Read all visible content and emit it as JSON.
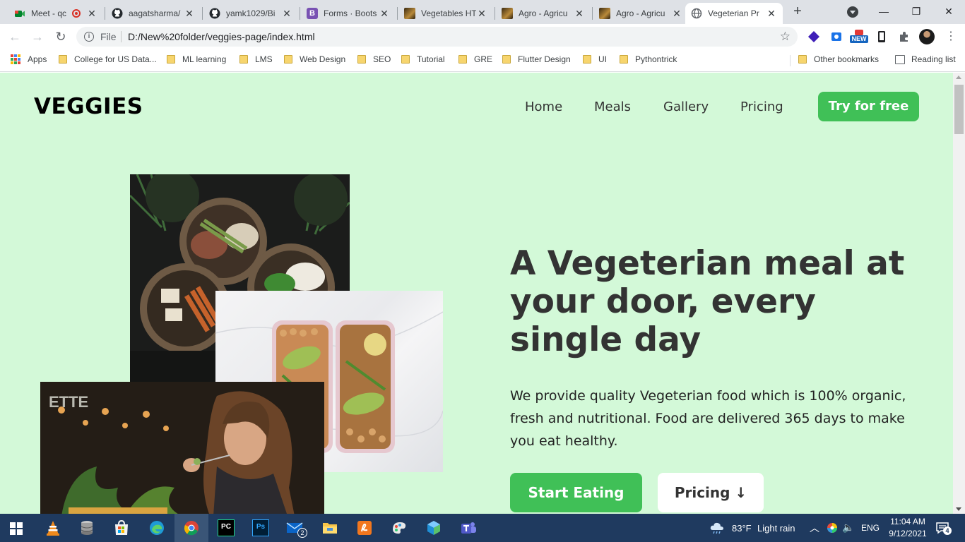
{
  "browser": {
    "tabs": [
      {
        "title": "Meet - qc",
        "icon": "google-meet-icon",
        "recording": true
      },
      {
        "title": "aagatsharma/",
        "icon": "github-icon"
      },
      {
        "title": "yamk1029/Bi",
        "icon": "github-icon"
      },
      {
        "title": "Forms · Boots",
        "icon": "bootstrap-icon"
      },
      {
        "title": "Vegetables HT",
        "icon": "site-icon"
      },
      {
        "title": "Agro - Agricu",
        "icon": "site-icon"
      },
      {
        "title": "Agro - Agricu",
        "icon": "site-icon"
      },
      {
        "title": "Vegeterian Pr",
        "icon": "globe-icon",
        "active": true
      }
    ],
    "new_tab": "+",
    "window_controls": {
      "minimize": "—",
      "restore": "❐",
      "close": "✕"
    },
    "address": {
      "scheme": "File",
      "url": "D:/New%20folder/veggies-page/index.html"
    },
    "bookmarks": [
      {
        "label": "Apps",
        "icon": "apps-grid-icon"
      },
      {
        "label": "College for US Data...",
        "icon": "folder-icon"
      },
      {
        "label": "ML learning",
        "icon": "folder-icon"
      },
      {
        "label": "LMS",
        "icon": "folder-icon"
      },
      {
        "label": "Web Design",
        "icon": "folder-icon"
      },
      {
        "label": "SEO",
        "icon": "folder-icon"
      },
      {
        "label": "Tutorial",
        "icon": "folder-icon"
      },
      {
        "label": "GRE",
        "icon": "folder-icon"
      },
      {
        "label": "Flutter Design",
        "icon": "folder-icon"
      },
      {
        "label": "UI",
        "icon": "folder-icon"
      },
      {
        "label": "Pythontrick",
        "icon": "folder-icon"
      }
    ],
    "other_bookmarks": "Other bookmarks",
    "reading_list": "Reading list",
    "extension_badge": "NEW"
  },
  "page": {
    "logo": "VEGGIES",
    "nav": {
      "home": "Home",
      "meals": "Meals",
      "gallery": "Gallery",
      "pricing": "Pricing",
      "cta": "Try for free"
    },
    "hero": {
      "title": "A Vegeterian meal at your door, every single day",
      "text": "We provide quality Vegeterian food which is 100% organic, fresh and nutritional. Food are delivered 365 days to make you eat healthy.",
      "primary_button": "Start Eating",
      "secondary_button": "Pricing ↓"
    },
    "colors": {
      "background": "#d3f9d8",
      "accent": "#40c057",
      "heading": "#333333"
    }
  },
  "taskbar": {
    "weather": {
      "temp": "83°F",
      "condition": "Light rain"
    },
    "language": "ENG",
    "time": "11:04 AM",
    "date": "9/12/2021",
    "mail_badge": "2",
    "notification_count": "4"
  }
}
